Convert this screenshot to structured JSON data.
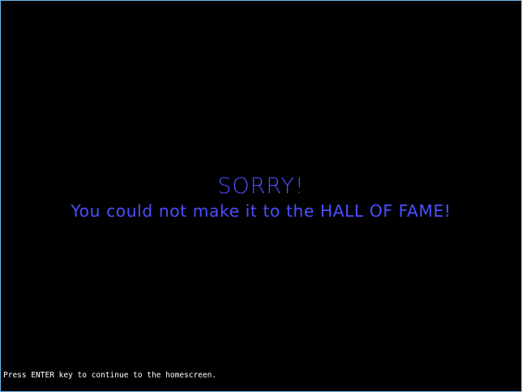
{
  "game_over": {
    "title": "SORRY!",
    "message": "You could not make it to the HALL OF FAME!",
    "prompt": "Press ENTER key to continue to the homescreen."
  },
  "colors": {
    "background": "#000000",
    "text_primary": "#4a50ff",
    "text_secondary": "#ffffff",
    "window_border": "#6fb7e8"
  }
}
